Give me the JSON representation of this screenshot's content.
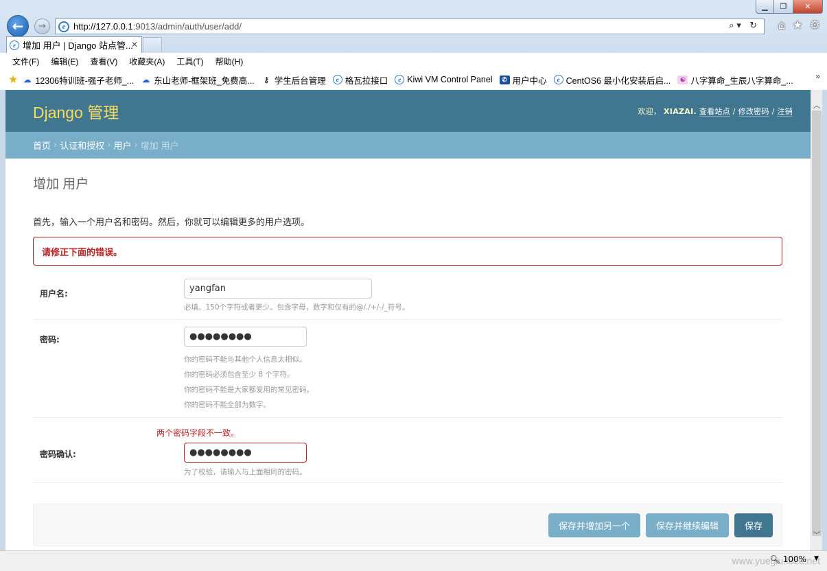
{
  "browser": {
    "window_controls": {
      "minimize": "▁",
      "maximize": "❐",
      "close": "✕"
    },
    "address": {
      "host": "http://127.0.0.1",
      "path": ":9013/admin/auth/user/add/"
    },
    "address_tools": "⌕▾ ↻",
    "tab": {
      "title": "增加 用户 | Django 站点管...",
      "close": "✕"
    },
    "menu": [
      "文件(F)",
      "编辑(E)",
      "查看(V)",
      "收藏夹(A)",
      "工具(T)",
      "帮助(H)"
    ],
    "favorites": [
      {
        "label": "12306特训班-强子老师_...",
        "icon": "cloud-icon"
      },
      {
        "label": "东山老师-框架班_免费高...",
        "icon": "cloud-icon"
      },
      {
        "label": "学生后台管理",
        "icon": "key-icon"
      },
      {
        "label": "格瓦拉接口",
        "icon": "ie-icon"
      },
      {
        "label": "Kiwi VM Control Panel",
        "icon": "ie-icon"
      },
      {
        "label": "用户中心",
        "icon": "telecom-icon"
      },
      {
        "label": "CentOS6 最小化安装后启...",
        "icon": "ie-icon"
      },
      {
        "label": "八字算命_生辰八字算命_...",
        "icon": "bazi-icon"
      }
    ],
    "zoom": "100%",
    "watermark": "www.yuegiu.tuzu.net"
  },
  "admin": {
    "branding": "Django 管理",
    "user_tools": {
      "welcome": "欢迎，",
      "username": "XIAZAI.",
      "view_site": "查看站点",
      "change_password": "修改密码",
      "logout": "注销",
      "sep": "/"
    },
    "breadcrumbs": {
      "home": "首页",
      "app": "认证和授权",
      "model": "用户",
      "current": "增加 用户",
      "sep": "›"
    },
    "title": "增加 用户",
    "intro": "首先，输入一个用户名和密码。然后，你就可以编辑更多的用户选项。",
    "errornote": "请修正下面的错误。",
    "fields": {
      "username": {
        "label": "用户名:",
        "value": "yangfan",
        "help": "必填。150个字符或者更少。包含字母，数字和仅有的@/./+/-/_符号。"
      },
      "password1": {
        "label": "密码:",
        "value": "●●●●●●●●",
        "help": [
          "你的密码不能与其他个人信息太相似。",
          "你的密码必须包含至少 8 个字符。",
          "你的密码不能是大家都爱用的常见密码。",
          "你的密码不能全部为数字。"
        ]
      },
      "password2": {
        "label": "密码确认:",
        "value": "●●●●●●●●",
        "error": "两个密码字段不一致。",
        "help": "为了校验，请输入与上面相同的密码。"
      }
    },
    "buttons": {
      "save_add": "保存并增加另一个",
      "save_continue": "保存并继续编辑",
      "save": "保存"
    }
  },
  "colors": {
    "header": "#417690",
    "breadcrumbs": "#79aec8",
    "branding": "#f5dd5d",
    "error": "#ba2121"
  }
}
